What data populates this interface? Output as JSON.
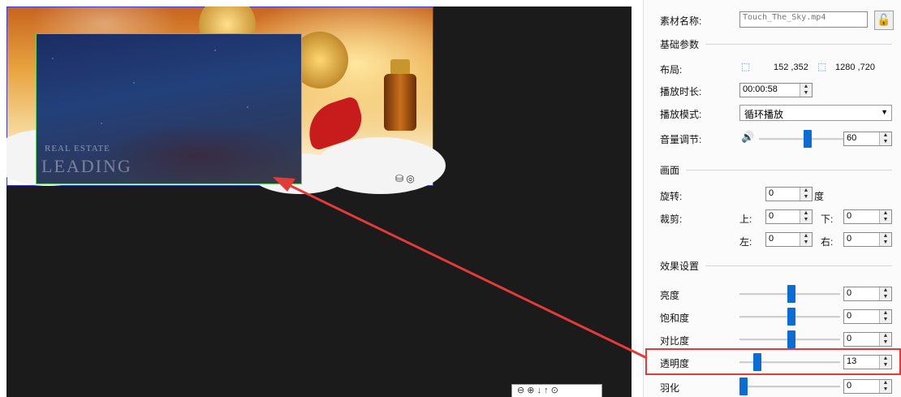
{
  "preview": {
    "watermark_line1": "REAL ESTATE",
    "watermark_line2": "LEADING",
    "zoom_controls": "⊖ ⊕ ↓ ↑ ⊙"
  },
  "panel": {
    "material_name_label": "素材名称:",
    "material_name_value": "Touch_The_Sky.mp4",
    "lock_icon": "unlock-icon",
    "basic_params_title": "基础参数",
    "layout_label": "布局:",
    "layout_position": "152 ,352",
    "layout_size": "1280 ,720",
    "duration_label": "播放时长:",
    "duration_value": "00:00:58",
    "play_mode_label": "播放模式:",
    "play_mode_value": "循环播放",
    "volume_label": "音量调节:",
    "volume_value": "60",
    "volume_fraction": 0.6,
    "picture_title": "画面",
    "rotate_label": "旋转:",
    "rotate_value": "0",
    "rotate_unit": "度",
    "crop_label": "裁剪:",
    "crop_top_label": "上:",
    "crop_top_value": "0",
    "crop_bottom_label": "下:",
    "crop_bottom_value": "0",
    "crop_left_label": "左:",
    "crop_left_value": "0",
    "crop_right_label": "右:",
    "crop_right_value": "0",
    "effects_title": "效果设置",
    "brightness_label": "亮度",
    "brightness_value": "0",
    "saturation_label": "饱和度",
    "saturation_value": "0",
    "contrast_label": "对比度",
    "contrast_value": "0",
    "opacity_label": "透明度",
    "opacity_value": "13",
    "feather_label": "羽化",
    "feather_value": "0"
  },
  "colors": {
    "annotation_red": "#e33a3a",
    "slider_blue": "#0a6cd4",
    "canvas_bg": "#1b1b1b"
  }
}
